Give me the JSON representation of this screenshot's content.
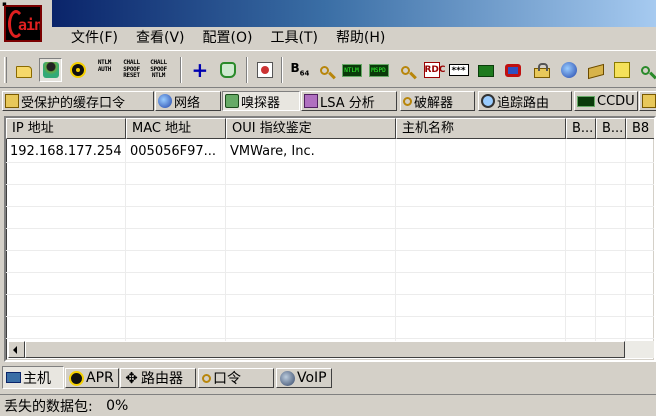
{
  "app": {
    "logo_text": "ain",
    "sysmenu_glyph": "▪"
  },
  "menu": [
    "文件(F)",
    "查看(V)",
    "配置(O)",
    "工具(T)",
    "帮助(H)"
  ],
  "toolbar": {
    "ntlm_auth": "NTLM\nAUTH",
    "chall_spoof_reset": "CHALL\nSPOOF\nRESET",
    "chall_spoof_ntlm": "CHALL\nSPOOF\nNTLM",
    "plus": "+",
    "b64": "B",
    "b64_sub": "64",
    "lcd1": "NTLM",
    "lcd2": "MSPD",
    "rdp": "RDC",
    "pwd": "***"
  },
  "tabs": [
    "受保护的缓存口令",
    "网络",
    "嗅探器",
    "LSA 分析",
    "破解器",
    "追踪路由",
    "CCDU",
    ""
  ],
  "columns": [
    "IP 地址",
    "MAC 地址",
    "OUI 指纹鉴定",
    "主机名称",
    "B...",
    "B...",
    "B8"
  ],
  "rows": [
    {
      "ip": "192.168.177.254",
      "mac": "005056F97...",
      "oui": "VMWare, Inc.",
      "host": ""
    }
  ],
  "bottom_tabs": [
    "主机",
    "APR",
    "路由器",
    "口令",
    "VoIP"
  ],
  "status": {
    "label": "丢失的数据包:",
    "value": "0%"
  }
}
